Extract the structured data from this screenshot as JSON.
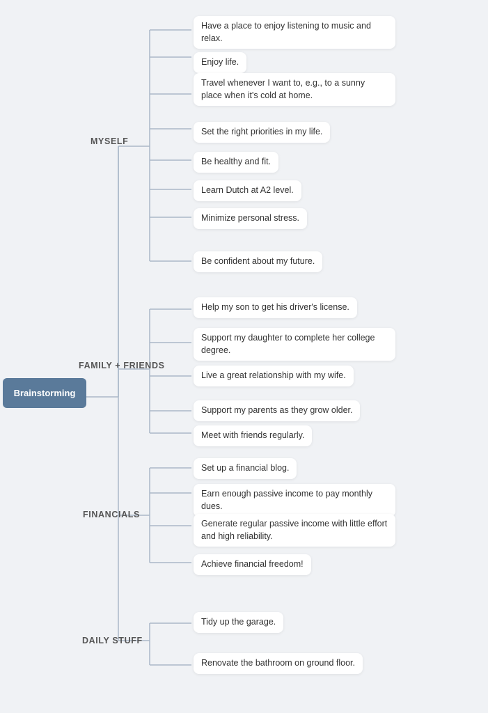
{
  "central": {
    "label": "Brainstorming"
  },
  "categories": {
    "myself": {
      "label": "MYSELF",
      "items": [
        "Have a place to enjoy listening to music and relax.",
        "Enjoy life.",
        "Travel whenever I want to, e.g., to a sunny place when it's cold at home.",
        "Set the right priorities in my life.",
        "Be healthy and fit.",
        "Learn Dutch at A2 level.",
        "Minimize personal stress.",
        "Be confident about my future."
      ]
    },
    "family": {
      "label": "FAMILY + FRIENDS",
      "items": [
        "Help my son to get his driver's license.",
        "Support my daughter to complete her college degree.",
        "Live a great relationship with my wife.",
        "Support my parents as they grow older.",
        "Meet with friends regularly."
      ]
    },
    "financials": {
      "label": "FINANCIALS",
      "items": [
        "Set up a financial blog.",
        "Earn enough passive income to pay monthly dues.",
        "Generate regular passive income with little effort and high reliability.",
        "Achieve financial freedom!"
      ]
    },
    "daily": {
      "label": "DAILY STUFF",
      "items": [
        "Tidy up the garage.",
        "Renovate the bathroom on ground floor."
      ]
    }
  },
  "colors": {
    "central_bg": "#5a7a9a",
    "central_text": "#ffffff",
    "leaf_bg": "#ffffff",
    "line_color": "#aab8c8",
    "background": "#f0f2f5"
  }
}
